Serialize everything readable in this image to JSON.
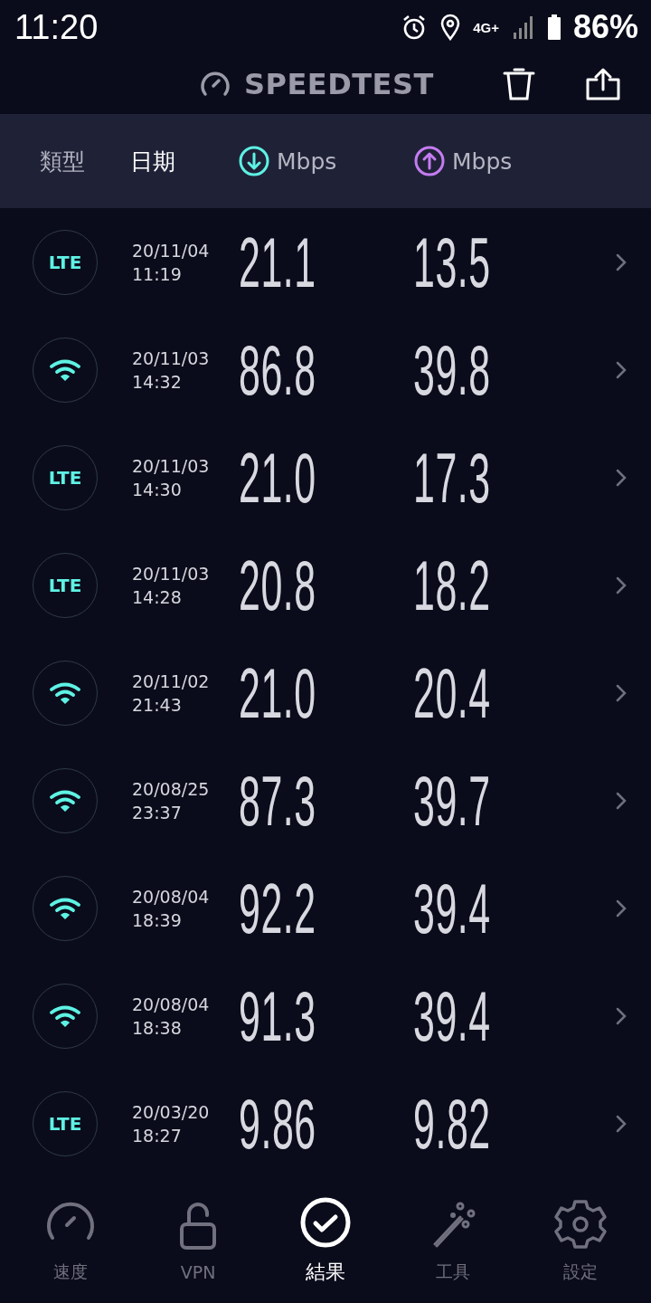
{
  "status_bar": {
    "time": "11:20",
    "network": "4G+",
    "battery": "86%"
  },
  "app_bar": {
    "title": "SPEEDTEST"
  },
  "columns": [
    {
      "kind": "text",
      "label": "類型",
      "selected": false
    },
    {
      "kind": "text",
      "label": "日期",
      "selected": true
    },
    {
      "kind": "download",
      "label": "Mbps",
      "selected": false
    },
    {
      "kind": "upload",
      "label": "Mbps",
      "selected": false
    }
  ],
  "results": [
    {
      "kind": "lte",
      "badge": "LTE",
      "date": "20/11/04",
      "time": "11:19",
      "download": "21.1",
      "upload": "13.5"
    },
    {
      "kind": "wifi",
      "date": "20/11/03",
      "time": "14:32",
      "download": "86.8",
      "upload": "39.8"
    },
    {
      "kind": "lte",
      "badge": "LTE",
      "date": "20/11/03",
      "time": "14:30",
      "download": "21.0",
      "upload": "17.3"
    },
    {
      "kind": "lte",
      "badge": "LTE",
      "date": "20/11/03",
      "time": "14:28",
      "download": "20.8",
      "upload": "18.2"
    },
    {
      "kind": "wifi",
      "date": "20/11/02",
      "time": "21:43",
      "download": "21.0",
      "upload": "20.4"
    },
    {
      "kind": "wifi",
      "date": "20/08/25",
      "time": "23:37",
      "download": "87.3",
      "upload": "39.7"
    },
    {
      "kind": "wifi",
      "date": "20/08/04",
      "time": "18:39",
      "download": "92.2",
      "upload": "39.4"
    },
    {
      "kind": "wifi",
      "date": "20/08/04",
      "time": "18:38",
      "download": "91.3",
      "upload": "39.4"
    },
    {
      "kind": "lte",
      "badge": "LTE",
      "date": "20/03/20",
      "time": "18:27",
      "download": "9.86",
      "upload": "9.82"
    }
  ],
  "bottom_nav": [
    {
      "kind": "speed",
      "label": "速度",
      "selected": false
    },
    {
      "kind": "vpn",
      "label": "VPN",
      "selected": false
    },
    {
      "kind": "results",
      "label": "結果",
      "selected": true
    },
    {
      "kind": "tools",
      "label": "工具",
      "selected": false
    },
    {
      "kind": "settings",
      "label": "設定",
      "selected": false
    }
  ]
}
